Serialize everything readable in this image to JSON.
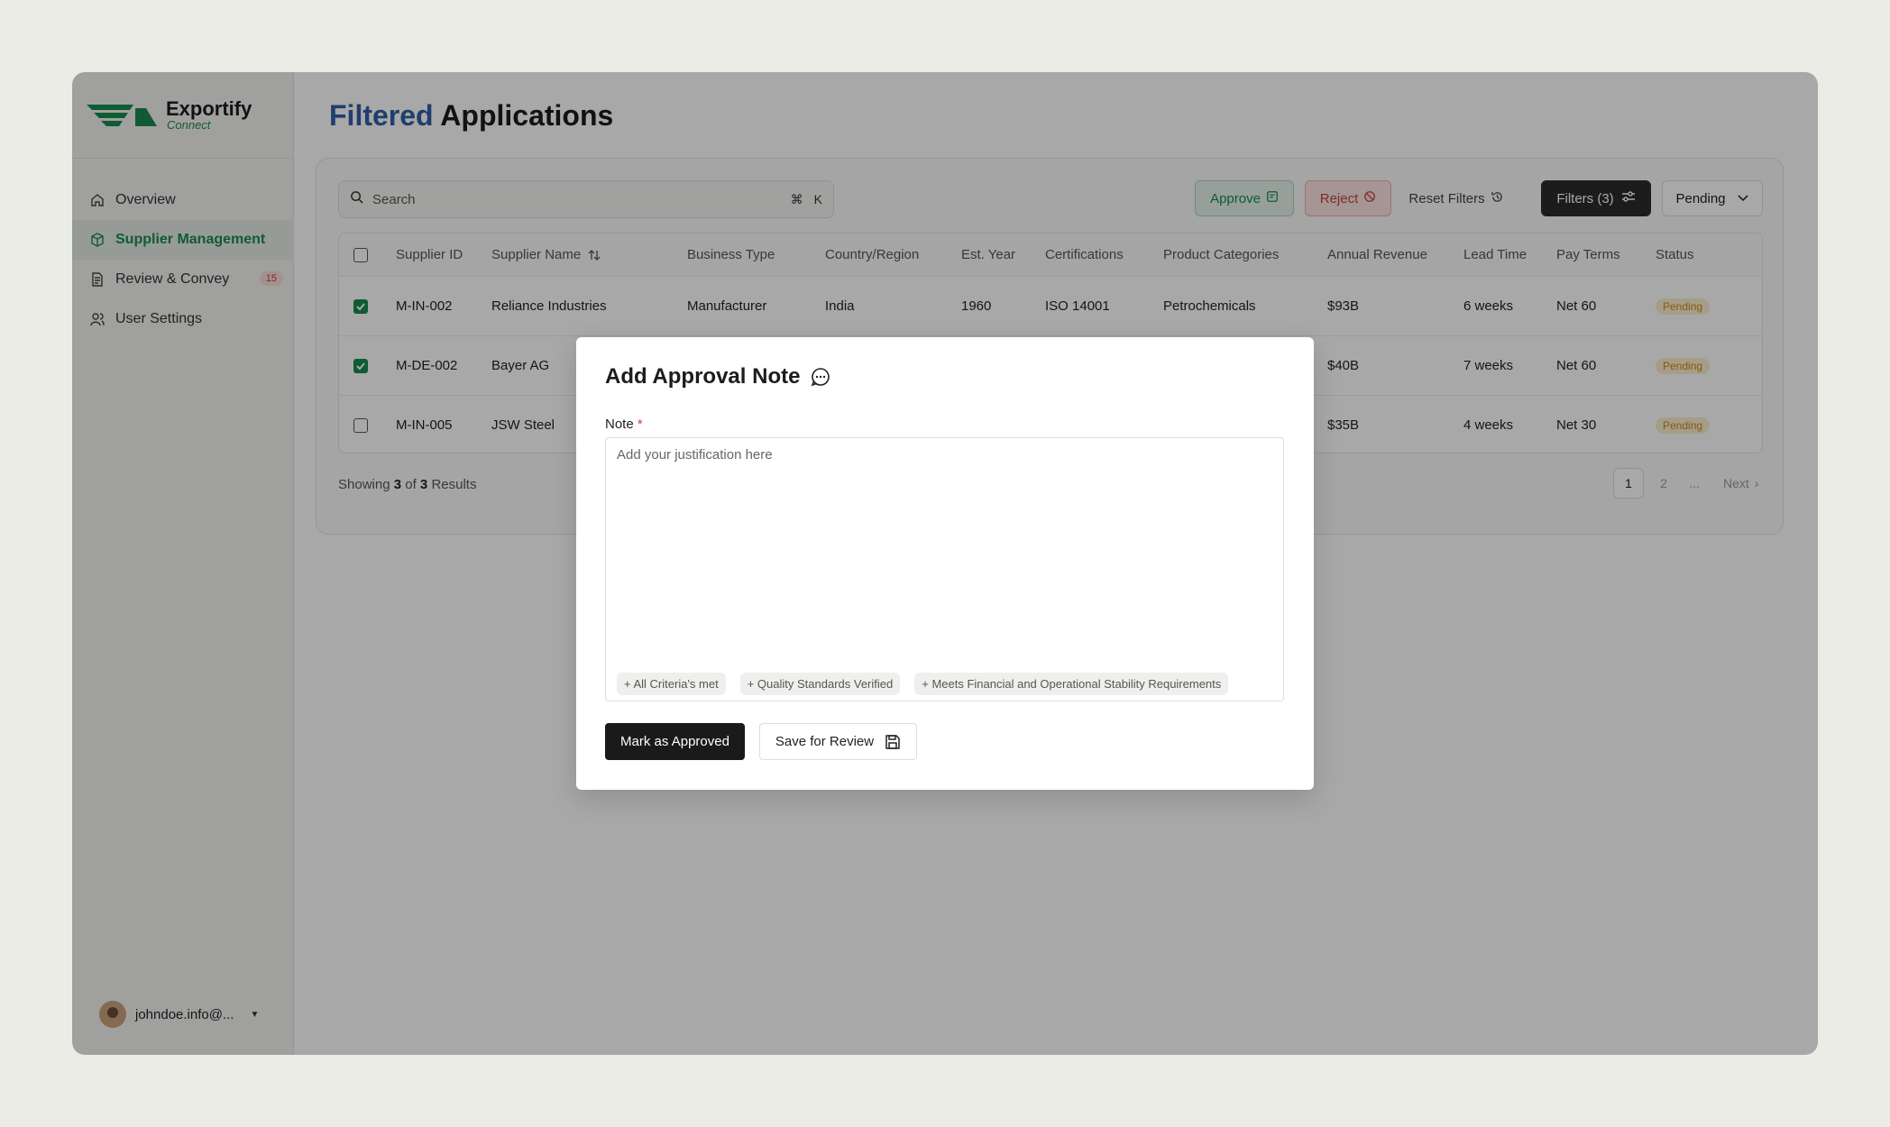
{
  "brand": {
    "name": "Exportify",
    "tagline": "Connect"
  },
  "sidebar": {
    "items": [
      {
        "label": "Overview",
        "icon": "home-icon"
      },
      {
        "label": "Supplier Management",
        "icon": "box-icon",
        "active": true
      },
      {
        "label": "Review & Convey",
        "icon": "document-icon",
        "badge": "15"
      },
      {
        "label": "User Settings",
        "icon": "users-icon"
      }
    ],
    "user": {
      "email": "johndoe.info@..."
    }
  },
  "page": {
    "title_accent": "Filtered",
    "title_rest": "Applications"
  },
  "toolbar": {
    "search_placeholder": "Search",
    "shortcut_symbol": "⌘",
    "shortcut_key": "K",
    "approve": "Approve",
    "reject": "Reject",
    "reset": "Reset Filters",
    "filters": "Filters (3)",
    "status_select": "Pending"
  },
  "table": {
    "headers": [
      "Supplier ID",
      "Supplier Name",
      "Business Type",
      "Country/Region",
      "Est. Year",
      "Certifications",
      "Product Categories",
      "Annual Revenue",
      "Lead Time",
      "Pay Terms",
      "Status"
    ],
    "rows": [
      {
        "checked": true,
        "id": "M-IN-002",
        "name": "Reliance Industries",
        "type": "Manufacturer",
        "country": "India",
        "year": "1960",
        "cert": "ISO 14001",
        "category": "Petrochemicals",
        "revenue": "$93B",
        "lead": "6 weeks",
        "terms": "Net 60",
        "status": "Pending"
      },
      {
        "checked": true,
        "id": "M-DE-002",
        "name": "Bayer AG",
        "type": "",
        "country": "",
        "year": "",
        "cert": "",
        "category": "",
        "revenue": "$40B",
        "lead": "7 weeks",
        "terms": "Net 60",
        "status": "Pending"
      },
      {
        "checked": false,
        "id": "M-IN-005",
        "name": "JSW Steel",
        "type": "",
        "country": "",
        "year": "",
        "cert": "",
        "category": "",
        "revenue": "$35B",
        "lead": "4 weeks",
        "terms": "Net 30",
        "status": "Pending"
      }
    ]
  },
  "footer": {
    "showing_prefix": "Showing",
    "shown": "3",
    "of": "of",
    "total": "3",
    "results": "Results",
    "pages": [
      "1",
      "2"
    ],
    "ellipsis": "...",
    "next": "Next"
  },
  "modal": {
    "title": "Add Approval Note",
    "note_label": "Note",
    "required_mark": "*",
    "placeholder": "Add your justification here",
    "value": "",
    "chips": [
      "+ All Criteria's met",
      "+ Quality Standards Verified",
      "+ Meets Financial and Operational Stability Requirements"
    ],
    "primary": "Mark as Approved",
    "secondary": "Save for Review"
  },
  "colors": {
    "brand_green": "#1a8a4c",
    "title_accent": "#2f5fa8",
    "pending": "#c98a14"
  }
}
